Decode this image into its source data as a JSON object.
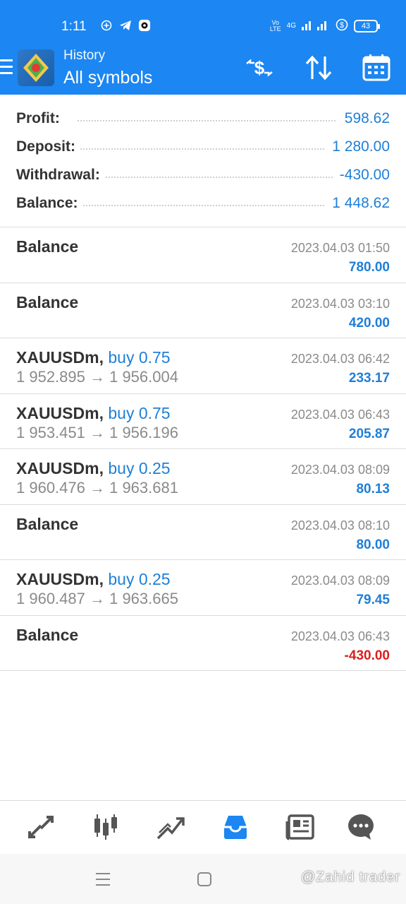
{
  "status_bar": {
    "time": "1:11",
    "network": "4G",
    "battery": "43"
  },
  "header": {
    "title": "History",
    "subtitle": "All symbols",
    "icons": [
      "menu-icon",
      "currency-exchange-icon",
      "sort-icon",
      "calendar-icon"
    ]
  },
  "summary": [
    {
      "label": "Profit:",
      "value": "598.62"
    },
    {
      "label": "Deposit:",
      "value": "1 280.00"
    },
    {
      "label": "Withdrawal:",
      "value": "-430.00"
    },
    {
      "label": "Balance:",
      "value": "1 448.62"
    }
  ],
  "deals": [
    {
      "name": "Balance",
      "kind": "",
      "prices": "",
      "datetime": "2023.04.03 01:50",
      "amount": "780.00",
      "negative": false
    },
    {
      "name": "Balance",
      "kind": "",
      "prices": "",
      "datetime": "2023.04.03 03:10",
      "amount": "420.00",
      "negative": false
    },
    {
      "name": "XAUUSDm,",
      "kind": "buy 0.75",
      "prices": "1 952.895 → 1 956.004",
      "datetime": "2023.04.03 06:42",
      "amount": "233.17",
      "negative": false
    },
    {
      "name": "XAUUSDm,",
      "kind": "buy 0.75",
      "prices": "1 953.451 → 1 956.196",
      "datetime": "2023.04.03 06:43",
      "amount": "205.87",
      "negative": false
    },
    {
      "name": "XAUUSDm,",
      "kind": "buy 0.25",
      "prices": "1 960.476 → 1 963.681",
      "datetime": "2023.04.03 08:09",
      "amount": "80.13",
      "negative": false
    },
    {
      "name": "Balance",
      "kind": "",
      "prices": "",
      "datetime": "2023.04.03 08:10",
      "amount": "80.00",
      "negative": false
    },
    {
      "name": "XAUUSDm,",
      "kind": "buy 0.25",
      "prices": "1 960.487 → 1 963.665",
      "datetime": "2023.04.03 08:09",
      "amount": "79.45",
      "negative": false
    },
    {
      "name": "Balance",
      "kind": "",
      "prices": "",
      "datetime": "2023.04.03 06:43",
      "amount": "-430.00",
      "negative": true
    }
  ],
  "bottom_nav": [
    "quotes-icon",
    "chart-icon",
    "trade-icon",
    "history-icon",
    "news-icon",
    "chat-icon"
  ],
  "watermark": "@Zahid trader",
  "colors": {
    "accent": "#1c86f2",
    "positive": "#1f7fd6",
    "negative": "#d9201f",
    "text": "#333333",
    "muted": "#8a8a8a"
  }
}
